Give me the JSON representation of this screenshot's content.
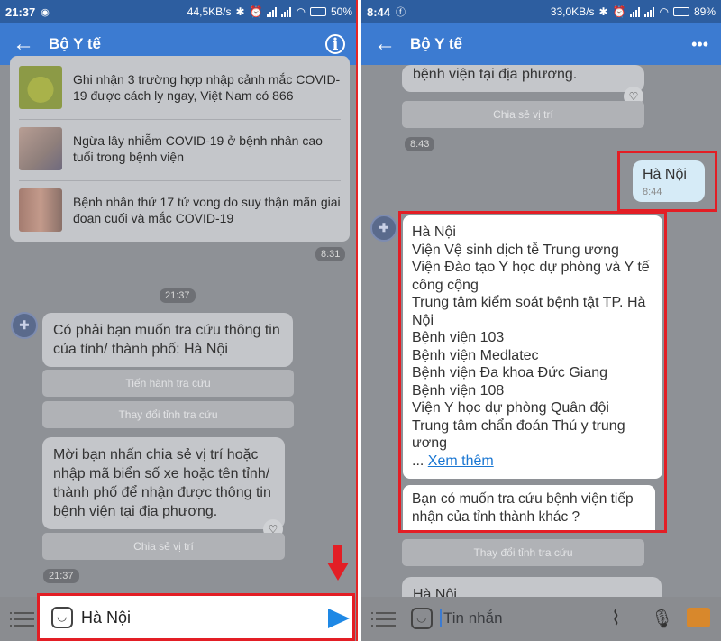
{
  "left": {
    "status": {
      "time": "21:37",
      "speed": "44,5KB/s",
      "battery": "50%"
    },
    "appbar": {
      "title": "Bộ Y tế"
    },
    "news": [
      {
        "text": "Ghi nhận 3 trường hợp nhập cảnh mắc COVID-19 được cách ly ngay, Việt Nam có 866"
      },
      {
        "text": "Ngừa lây nhiễm COVID-19 ở bệnh nhân cao tuổi trong bệnh viện"
      },
      {
        "text": "Bệnh nhân thứ 17 tử vong do suy thận mãn giai đoạn cuối và mắc COVID-19"
      }
    ],
    "news_time": "8:31",
    "day_time": "21:37",
    "bubble1": "Có phải bạn muốn tra cứu thông tin của tỉnh/ thành phố: Hà Nội",
    "btn_search": "Tiến hành tra cứu",
    "btn_change": "Thay đổi tỉnh tra cứu",
    "bubble2": "Mời bạn nhấn chia sẻ vị trí hoặc nhập mã biển số xe hoặc tên tỉnh/ thành phố để nhận được thông tin bệnh viện tại địa phương.",
    "btn_share": "Chia sẻ vị trí",
    "time2": "21:37",
    "input_value": "Hà Nội"
  },
  "right": {
    "status": {
      "time": "8:44",
      "speed": "33,0KB/s",
      "battery": "89%"
    },
    "appbar": {
      "title": "Bộ Y tế",
      "more": "•••"
    },
    "prev_text": "bệnh viện tại địa phương.",
    "btn_share": "Chia sẻ vị trí",
    "time1": "8:43",
    "user_msg": "Hà Nội",
    "user_time": "8:44",
    "list": [
      "Hà Nội",
      "Viện Vệ sinh dịch tễ Trung ương",
      "Viện Đào tạo Y học dự phòng và Y tế công cộng",
      "Trung tâm kiểm soát bệnh tật TP. Hà Nội",
      "Bệnh viện 103",
      "Bệnh viện Medlatec",
      "Bệnh viện Đa khoa Đức Giang",
      "Bệnh viện 108",
      "Viện Y học dự phòng Quân đội",
      "Trung tâm chẩn đoán Thú y trung ương"
    ],
    "more_prefix": "... ",
    "more_link": "Xem thêm",
    "question": "Bạn có muốn tra cứu bệnh viện tiếp nhận của tỉnh thành khác ?",
    "btn_change": "Thay đổi tỉnh tra cứu",
    "last_msg": "Hà Nội",
    "input_placeholder": "Tin nhắn"
  },
  "colors": {
    "highlight": "#e31e25",
    "send": "#1e88e5",
    "link": "#1976d2"
  }
}
